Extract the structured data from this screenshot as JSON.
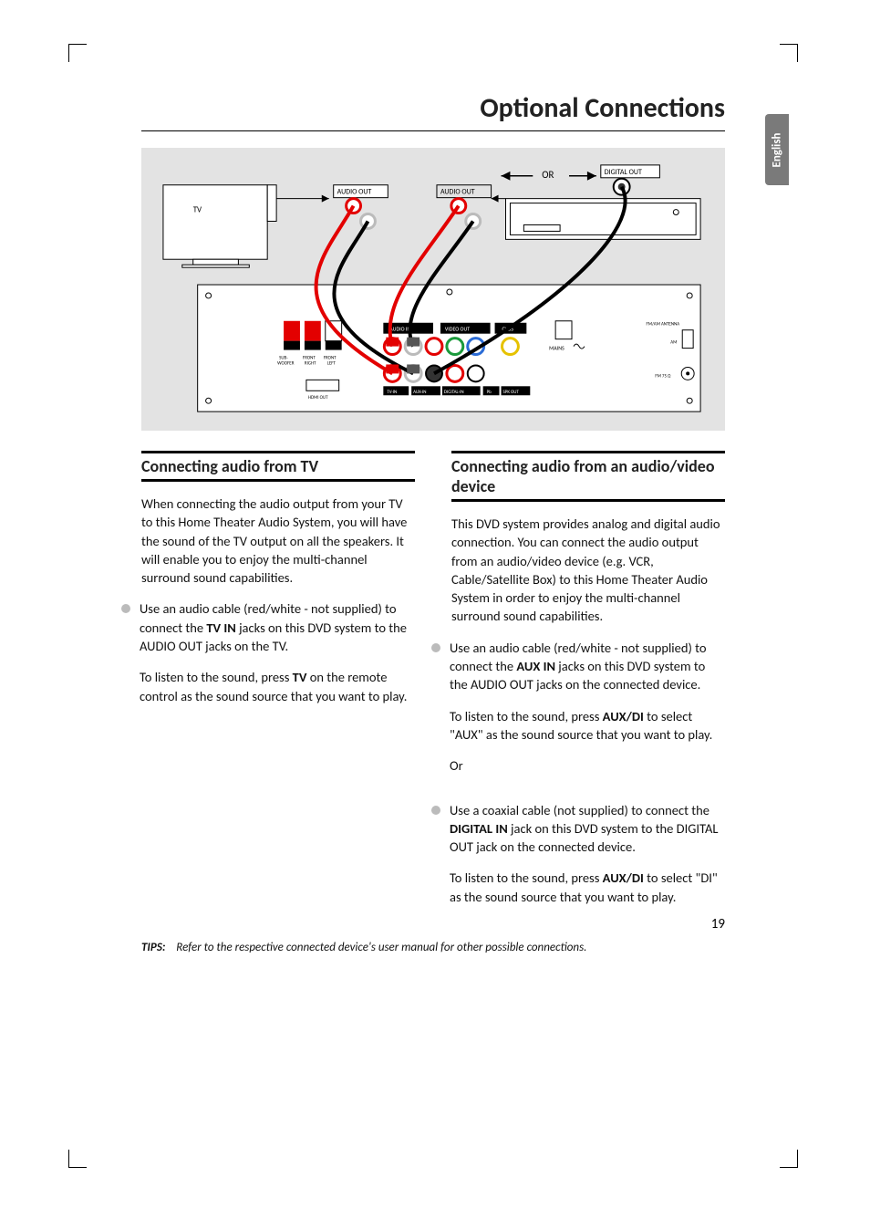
{
  "page": {
    "title": "Optional Connections",
    "language_tab": "English",
    "number": "19"
  },
  "diagram": {
    "tv_label": "TV",
    "audio_out_1": "AUDIO OUT",
    "audio_out_2": "AUDIO OUT",
    "or_label": "OR",
    "digital_out": "DIGITAL OUT",
    "back_labels": {
      "sub": "SUB-\nWOOFER",
      "front_right": "FRONT\nRIGHT",
      "front_left": "FRONT\nLEFT",
      "audio_in": "AUDIO IN",
      "video_out": "VIDEO OUT",
      "cvbs": "CVBS",
      "mains": "MAINS",
      "fm_am_ant": "FM/AM ANTENNA",
      "am": "AM",
      "fm": "FM 75 Ω",
      "hdmi_out": "HDMI OUT",
      "tv_in": "TV-IN",
      "aux_in": "AUX-IN",
      "digital_in": "DIGITAL-IN",
      "pb": "Pb",
      "spk_out": "SPK OUT"
    }
  },
  "left": {
    "heading": "Connecting audio from TV",
    "p1": "When connecting the audio output from your TV to this Home Theater Audio System, you will have the sound of the TV output on all the speakers.  It will enable you to enjoy the multi-channel surround sound capabilities.",
    "b1_pre": "Use an audio cable (red/white - not supplied) to connect the ",
    "b1_bold": "TV IN",
    "b1_post": " jacks on this DVD system to the AUDIO OUT jacks on the TV.",
    "p2_pre": "To listen to the sound, press ",
    "p2_bold": "TV",
    "p2_post": " on the remote control as the sound source that you want to play."
  },
  "right": {
    "heading": "Connecting audio from an audio/video device",
    "p1": "This DVD system provides analog and digital audio connection. You can connect the audio output from an audio/video device (e.g. VCR, Cable/Satellite Box) to this Home Theater Audio System in order to enjoy the multi-channel surround sound capabilities.",
    "b1_pre": "Use an audio cable (red/white - not supplied) to connect the ",
    "b1_bold": "AUX IN",
    "b1_post": " jacks on this DVD system to the AUDIO OUT jacks on the connected device.",
    "p2_pre": "To listen to the sound, press ",
    "p2_bold": "AUX/DI",
    "p2_post": " to select \"AUX\" as the sound source that you want to play.",
    "or": "Or",
    "b2_pre": "Use a coaxial cable (not supplied) to connect the ",
    "b2_bold": "DIGITAL IN",
    "b2_post": " jack on this DVD system to the DIGITAL OUT jack on the connected device.",
    "p3_pre": "To listen to the sound, press ",
    "p3_bold": "AUX/DI",
    "p3_post": " to select \"DI\" as the sound source that you want to play."
  },
  "tips": {
    "label": "TIPS:",
    "text": "Refer to the respective connected device's user manual for other possible connections."
  }
}
